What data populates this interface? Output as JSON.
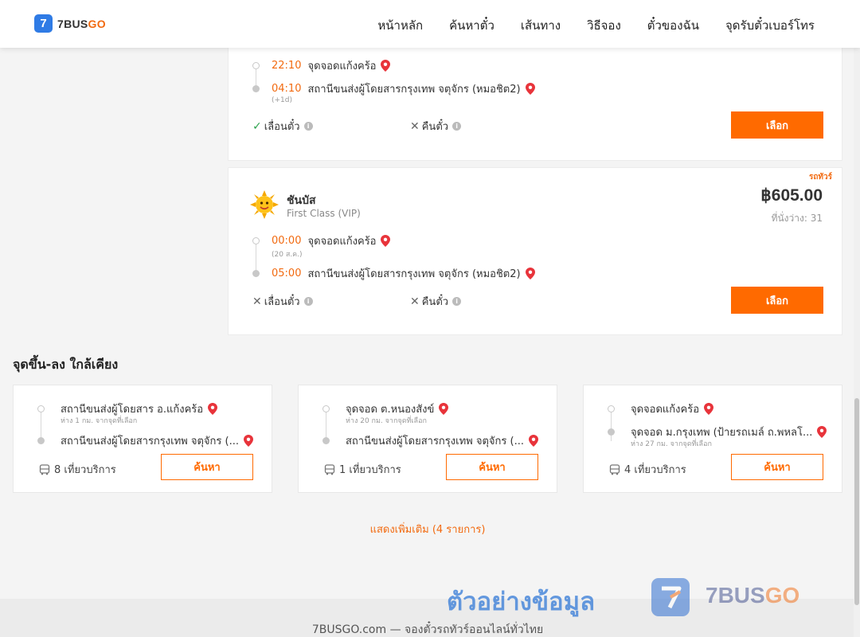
{
  "header": {
    "logo_mark": "7",
    "logo_text_a": "7BUS",
    "logo_text_b": "GO",
    "nav": [
      "หน้าหลัก",
      "ค้นหาตั๋ว",
      "เส้นทาง",
      "วิธีจอง",
      "ตั๋วของฉัน",
      "จุดรับตั๋วเบอร์โทร"
    ]
  },
  "trips": [
    {
      "departure_time": "22:10",
      "departure_place": "จุดจอดแก้งคร้อ",
      "arrival_time": "04:10",
      "arrival_place": "สถานีขนส่งผู้โดยสารกรุงเทพ จตุจักร (หมอชิต2)",
      "arrival_note": "(+1d)",
      "reschedule_label": "เลื่อนตั๋ว",
      "reschedule_allowed": true,
      "refund_label": "คืนตั๋ว",
      "refund_allowed": false,
      "select_label": "เลือก"
    },
    {
      "tag": "รถทัวร์",
      "company": "ชันบัส",
      "bus_class": "First Class (VIP)",
      "price": "฿605.00",
      "seats": "ที่นั่งว่าง: 31",
      "departure_time": "00:00",
      "departure_place": "จุดจอดแก้งคร้อ",
      "departure_note": "(20 ส.ค.)",
      "arrival_time": "05:00",
      "arrival_place": "สถานีขนส่งผู้โดยสารกรุงเทพ จตุจักร (หมอชิต2)",
      "reschedule_label": "เลื่อนตั๋ว",
      "reschedule_allowed": false,
      "refund_label": "คืนตั๋ว",
      "refund_allowed": false,
      "select_label": "เลือก"
    }
  ],
  "nearby": {
    "title": "จุดขึ้น-ลง ใกล้เคียง",
    "cards": [
      {
        "from": "สถานีขนส่งผู้โดยสาร อ.แก้งคร้อ",
        "from_distance": "ห่าง 1 กม. จากจุดที่เลือก",
        "to": "สถานีขนส่งผู้โดยสารกรุงเทพ จตุจักร (...",
        "to_distance": "",
        "trips": "8 เที่ยวบริการ",
        "search_label": "ค้นหา"
      },
      {
        "from": "จุดจอด ต.หนองสังข์",
        "from_distance": "ห่าง 20 กม. จากจุดที่เลือก",
        "to": "สถานีขนส่งผู้โดยสารกรุงเทพ จตุจักร (...",
        "to_distance": "",
        "trips": "1 เที่ยวบริการ",
        "search_label": "ค้นหา"
      },
      {
        "from": "จุดจอดแก้งคร้อ",
        "from_distance": "",
        "to": "จุดจอด ม.กรุงเทพ (ป้ายรถเมล์ ถ.พหลโ...",
        "to_distance": "ห่าง 27 กม. จากจุดที่เลือก",
        "trips": "4 เที่ยวบริการ",
        "search_label": "ค้นหา"
      }
    ],
    "show_more": "แสดงเพิ่มเติม (4 รายการ)"
  },
  "watermark": {
    "text": "ตัวอย่างข้อมูล",
    "logo_mark": "7",
    "brand_a": "7BUS",
    "brand_b": "GO"
  },
  "footer": {
    "text": "7BUSGO.com — จองตั๋วรถทัวร์ออนไลน์ทั่วไทย"
  },
  "colors": {
    "accent": "#ff6a00",
    "time": "#f26a10",
    "logo_blue": "#2f7be5",
    "pin_red": "#e8343b",
    "check_green": "#2ea44f"
  }
}
